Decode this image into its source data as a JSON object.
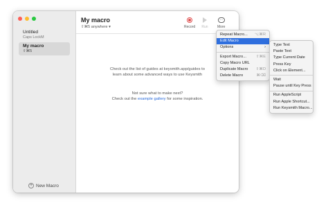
{
  "colors": {
    "close": "#fe5f57",
    "minimize": "#febc2e",
    "maximize": "#28c840",
    "accent": "#2f6fde",
    "record": "#e05050"
  },
  "sidebar": {
    "items": [
      {
        "name": "Untitled",
        "sub": "Caps LockM"
      },
      {
        "name": "My macro",
        "sub": "⇧⌘5"
      }
    ],
    "new_macro_label": "New Macro"
  },
  "header": {
    "title": "My macro",
    "shortcut": "⇧⌘5",
    "scope": "anywhere",
    "record_label": "Record",
    "run_label": "Run",
    "more_label": "More"
  },
  "body": {
    "line1": "Check out the list of guides at keysmith.app/guides to",
    "line2": "learn about some advanced ways to use Keysmith",
    "line3": "Not sure what to make next?",
    "line4_pre": "Check out the",
    "line4_link": "example gallery",
    "line4_post": "for some inspiration."
  },
  "more_menu": {
    "items": [
      {
        "label": "Repeat Macro...",
        "shortcut": "⌥⌘R"
      },
      {
        "label": "Edit Macro",
        "shortcut": ""
      },
      {
        "label": "Options",
        "shortcut": ""
      },
      {
        "label": "Export Macro...",
        "shortcut": "⇧⌘E"
      },
      {
        "label": "Copy Macro URL",
        "shortcut": ""
      },
      {
        "label": "Duplicate Macro",
        "shortcut": "⇧⌘D"
      },
      {
        "label": "Delete Macro",
        "shortcut": "⌘⌫"
      }
    ]
  },
  "submenu": {
    "items": [
      "Type Text",
      "Paste Text",
      "Type Current Date",
      "Press Key",
      "Click on Element...",
      "Wait",
      "Pause until Key Press",
      "Run AppleScript",
      "Run Apple Shortcut...",
      "Run Keysmith Macro..."
    ]
  }
}
